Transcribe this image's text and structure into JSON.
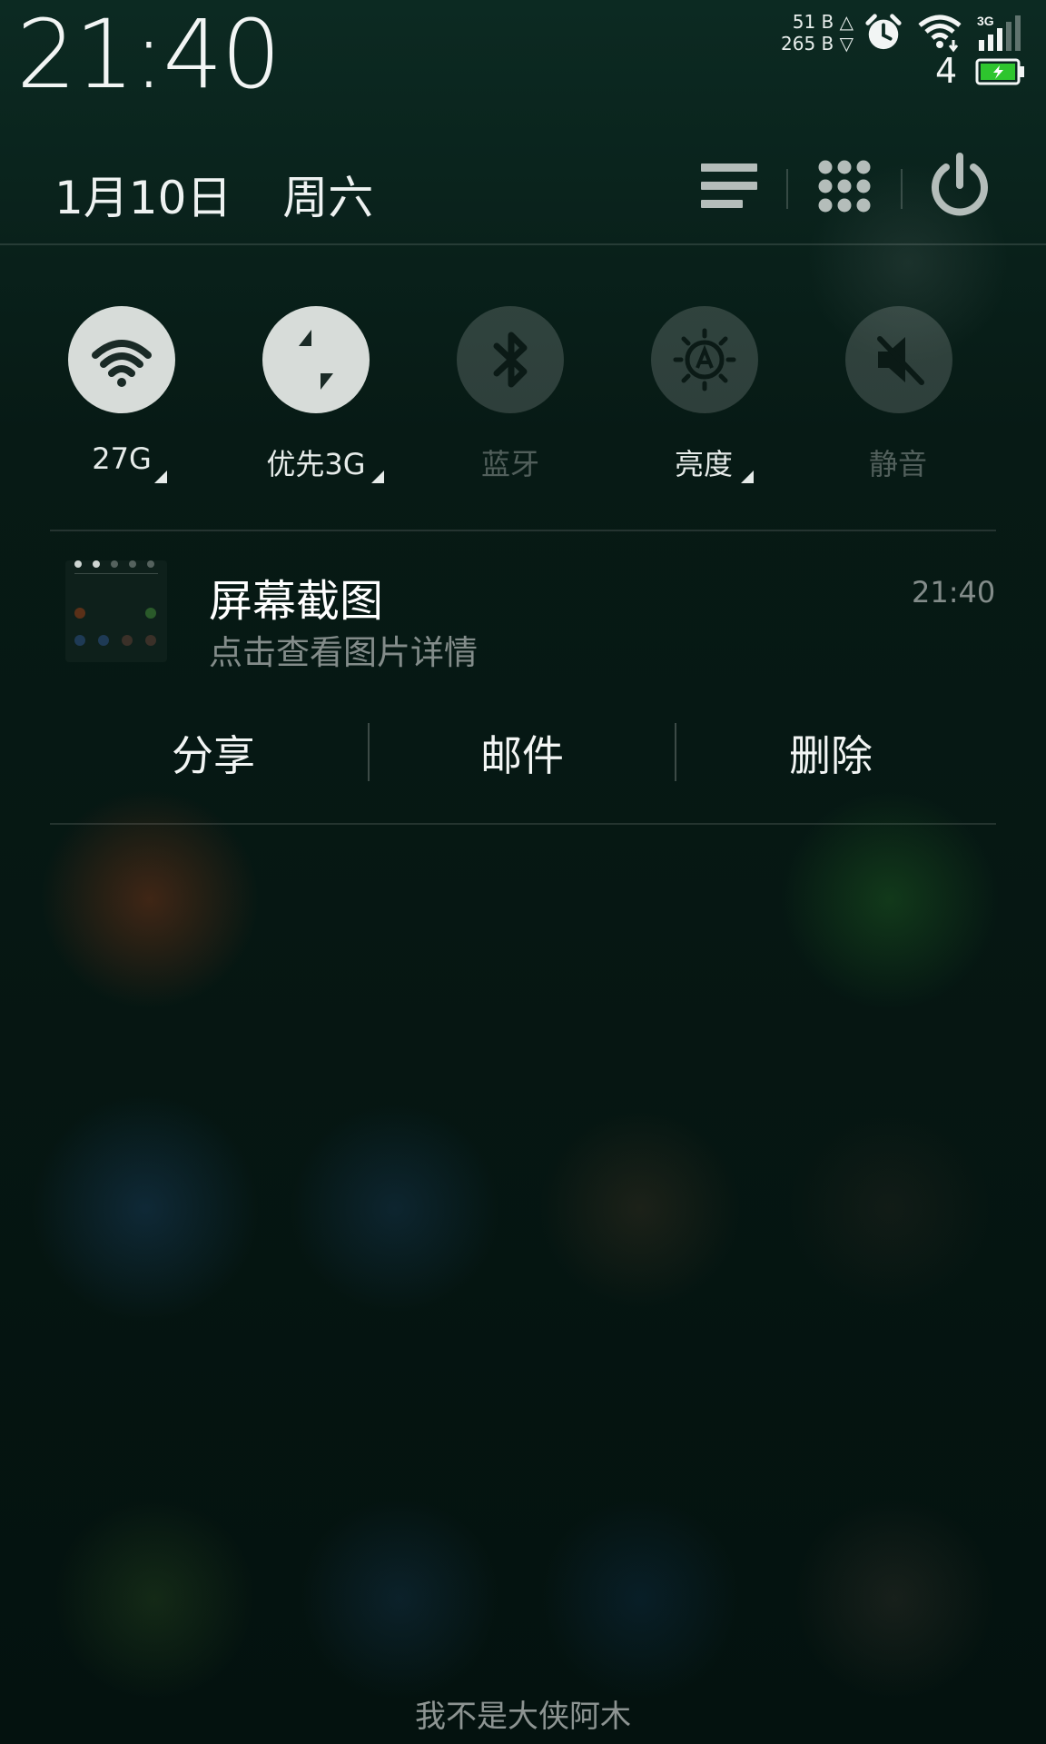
{
  "status_bar": {
    "time": "21:40",
    "net_up": "51 B △",
    "net_down": "265 B ▽",
    "sim_number": "4",
    "icons": [
      "alarm-icon",
      "wifi-icon",
      "3g-signal-icon",
      "battery-charging-icon"
    ],
    "network_type": "3G"
  },
  "header": {
    "date": "1月10日",
    "weekday": "周六",
    "buttons": [
      "list-menu-icon",
      "apps-grid-icon",
      "power-icon"
    ]
  },
  "toggles": [
    {
      "label": "27G",
      "icon": "wifi-icon",
      "state": "on",
      "has_arrow": true
    },
    {
      "label": "优先3G",
      "icon": "data-transfer-icon",
      "state": "on",
      "has_arrow": true
    },
    {
      "label": "蓝牙",
      "icon": "bluetooth-icon",
      "state": "off",
      "has_arrow": false
    },
    {
      "label": "亮度",
      "icon": "brightness-auto-icon",
      "state": "off",
      "has_arrow": true
    },
    {
      "label": "静音",
      "icon": "mute-icon",
      "state": "off",
      "has_arrow": false
    }
  ],
  "notification": {
    "title": "屏幕截图",
    "subtitle": "点击查看图片详情",
    "time": "21:40",
    "actions": [
      "分享",
      "邮件",
      "删除"
    ]
  },
  "footer": {
    "watermark": "我不是大侠阿木"
  },
  "colors": {
    "toggle_on": "#d7dcd9",
    "toggle_off": "rgba(255,255,255,0.16)",
    "battery_green": "#2ec52e",
    "background": "#04120f"
  }
}
